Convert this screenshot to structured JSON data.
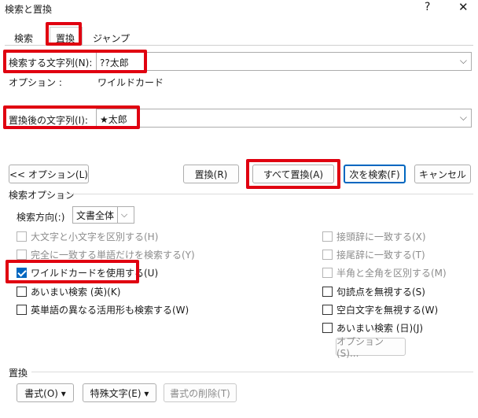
{
  "window": {
    "title": "検索と置換",
    "help": "?",
    "close": "✕"
  },
  "tabs": [
    {
      "label": "検索"
    },
    {
      "label": "置換"
    },
    {
      "label": "ジャンプ"
    }
  ],
  "find": {
    "label": "検索する文字列(N):",
    "value": "??太郎"
  },
  "options_line": {
    "label": "オプション :",
    "value": "ワイルドカード"
  },
  "replace": {
    "label": "置換後の文字列(I):",
    "value": "★太郎"
  },
  "buttons": {
    "less_options": "<< オプション(L)",
    "replace": "置換(R)",
    "replace_all": "すべて置換(A)",
    "find_next": "次を検索(F)",
    "cancel": "キャンセル"
  },
  "search_options": {
    "title": "検索オプション",
    "direction_label": "検索方向(:)",
    "direction_value": "文書全体",
    "left": [
      {
        "label": "大文字と小文字を区別する(H)",
        "checked": false,
        "disabled": true
      },
      {
        "label": "完全に一致する単語だけを検索する(Y)",
        "checked": false,
        "disabled": true
      },
      {
        "label": "ワイルドカードを使用する(U)",
        "checked": true,
        "disabled": false
      },
      {
        "label": "あいまい検索 (英)(K)",
        "checked": false,
        "disabled": false
      },
      {
        "label": "英単語の異なる活用形も検索する(W)",
        "checked": false,
        "disabled": false
      }
    ],
    "right": [
      {
        "label": "接頭辞に一致する(X)",
        "checked": false,
        "disabled": true
      },
      {
        "label": "接尾辞に一致する(T)",
        "checked": false,
        "disabled": true
      },
      {
        "label": "半角と全角を区別する(M)",
        "checked": false,
        "disabled": true
      },
      {
        "label": "句読点を無視する(S)",
        "checked": false,
        "disabled": false
      },
      {
        "label": "空白文字を無視する(W)",
        "checked": false,
        "disabled": false
      },
      {
        "label": "あいまい検索 (日)(J)",
        "checked": false,
        "disabled": false
      }
    ],
    "fuzzy_options_button": "オプション(S)..."
  },
  "replace_section": {
    "title": "置換",
    "format": "書式(O) ▾",
    "special": "特殊文字(E) ▾",
    "clear_format": "書式の削除(T)"
  },
  "colors": {
    "highlight": "#e00010",
    "accent": "#0067c0"
  }
}
